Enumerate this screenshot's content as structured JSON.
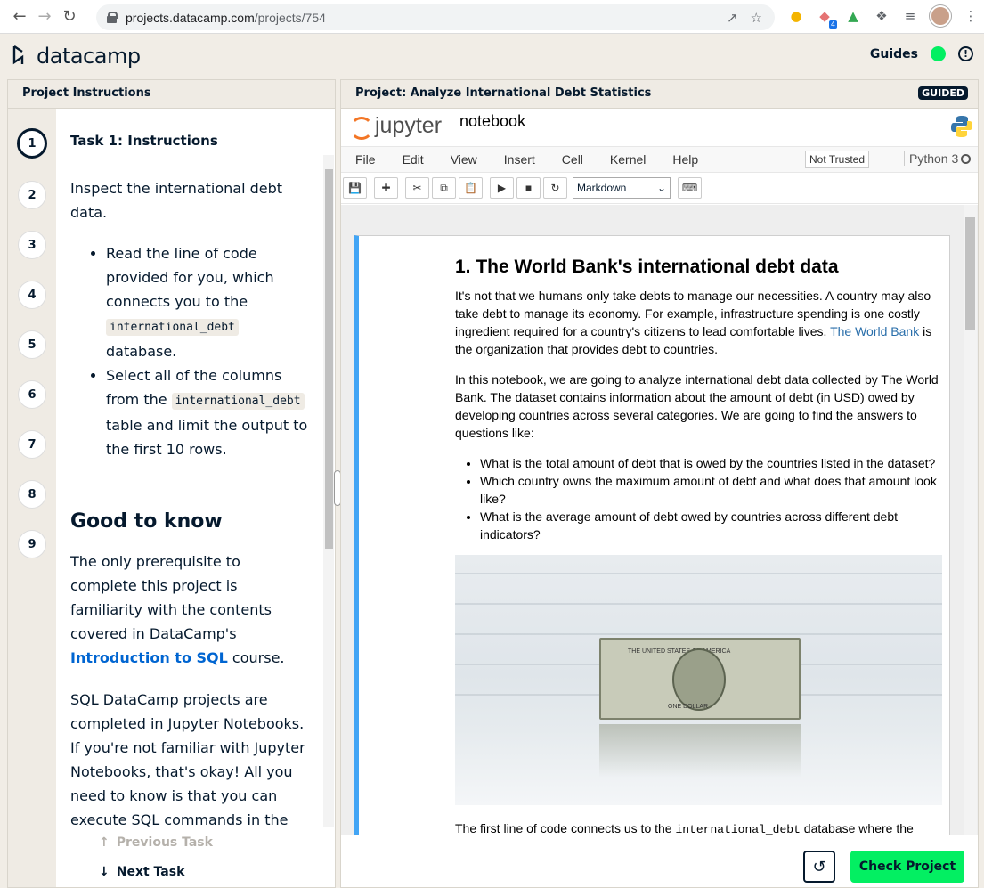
{
  "browser": {
    "url_host": "projects.datacamp.com",
    "url_path": "/projects/754",
    "extension_badge": "4"
  },
  "header": {
    "logo_text": "datacamp",
    "guides_label": "Guides",
    "info_icon": "!"
  },
  "left": {
    "title": "Project Instructions",
    "steps": [
      "1",
      "2",
      "3",
      "4",
      "5",
      "6",
      "7",
      "8",
      "9"
    ],
    "task_title": "Task 1: Instructions",
    "intro": "Inspect the international debt data.",
    "bullet1_a": "Read the line of code provided for you, which connects you to the",
    "bullet1_code": "international_debt",
    "bullet1_b": "database.",
    "bullet2_a": "Select all of the columns from the",
    "bullet2_code": "international_debt",
    "bullet2_b": "table and limit the output to the first 10 rows.",
    "good_title": "Good to know",
    "good_p1_a": "The only prerequisite to complete this project is familiarity with the contents covered in DataCamp's",
    "good_p1_link": "Introduction to SQL",
    "good_p1_b": "course.",
    "good_p2": "SQL DataCamp projects are completed in Jupyter Notebooks. If you're not familiar with Jupyter Notebooks, that's okay! All you need to know is that you can execute SQL commands in the code cells provided, as long as you",
    "prev_task": "Previous Task",
    "next_task": "Next Task"
  },
  "right": {
    "title": "Project: Analyze International Debt Statistics",
    "badge": "GUIDED",
    "jupyter_text": "jupyter",
    "notebook_name": "notebook",
    "menu": [
      "File",
      "Edit",
      "View",
      "Insert",
      "Cell",
      "Kernel",
      "Help"
    ],
    "not_trusted": "Not Trusted",
    "kernel": "Python 3",
    "cell_type": "Markdown",
    "md_title": "1. The World Bank's international debt data",
    "md_p1_a": "It's not that we humans only take debts to manage our necessities. A country may also take debt to manage its economy. For example, infrastructure spending is one costly ingredient required for a country's citizens to lead comfortable lives.",
    "md_p1_link": "The World Bank",
    "md_p1_b": "is the organization that provides debt to countries.",
    "md_p2": "In this notebook, we are going to analyze international debt data collected by The World Bank. The dataset contains information about the amount of debt (in USD) owed by developing countries across several categories. We are going to find the answers to questions like:",
    "md_list": [
      "What is the total amount of debt that is owed by the countries listed in the dataset?",
      "Which country owns the maximum amount of debt and what does that amount look like?",
      "What is the average amount of debt owed by countries across different debt indicators?"
    ],
    "md_p3_a": "The first line of code connects us to the",
    "md_p3_code": "international_debt",
    "md_p3_b": "database where the table",
    "bill_top": "THE UNITED STATES OF AMERICA",
    "bill_bottom": "ONE DOLLAR",
    "check_label": "Check Project"
  }
}
